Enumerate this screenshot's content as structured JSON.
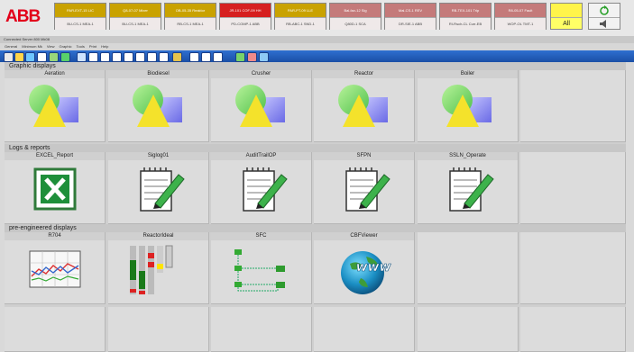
{
  "brand": {
    "logo_text": "ABB"
  },
  "alarm_list": [
    {
      "top": "PAR-EXT-15 LIC",
      "bottom": "BU-CS-1 MEA-1",
      "color": "#c9a200"
    },
    {
      "top": "Q8-07-07 Mixer",
      "bottom": "BU-CS-1 MEA-1",
      "color": "#c9a200"
    },
    {
      "top": "OB-05-35 Reaktor",
      "bottom": "RB-CS-1 MEA-1",
      "color": "#c9a200"
    },
    {
      "top": "JR-101 COF-09 HH",
      "bottom": "PD-COMP-1 ABB",
      "color": "#d61f1f"
    },
    {
      "top": "PAR-PT-09 LLE",
      "bottom": "RB-ABC-1 SND-1",
      "color": "#c9a200"
    },
    {
      "top": "Bal-fav-12 Sig",
      "bottom": "Q80D-1 SCA",
      "color": "#c47a7a"
    },
    {
      "top": "Mal-CS-1 REV",
      "bottom": "DR-SIE-1 ABB",
      "color": "#c47a7a"
    },
    {
      "top": "RB-TEX-101 Trip",
      "bottom": "RI-Rsch-CL Curr-EB",
      "color": "#c47a7a"
    },
    {
      "top": "R8-05-07 Fault",
      "bottom": "WOP-OL TMT-1",
      "color": "#c47a7a"
    }
  ],
  "ack": {
    "top_label": "",
    "bottom_label": "All"
  },
  "window": {
    "title": "Connected Server 800 Mk08"
  },
  "menu": [
    "General",
    "Minimum Mk",
    "View",
    "Graphic",
    "Tools",
    "Print",
    "Help"
  ],
  "sections": [
    {
      "title": "Graphic displays",
      "tiles": [
        {
          "name": "Aeration",
          "icon": "shapes-icon"
        },
        {
          "name": "Biodiesel",
          "icon": "shapes-icon"
        },
        {
          "name": "Crusher",
          "icon": "shapes-icon"
        },
        {
          "name": "Reactor",
          "icon": "shapes-icon"
        },
        {
          "name": "Boiler",
          "icon": "shapes-icon"
        }
      ]
    },
    {
      "title": "Logs & reports",
      "tiles": [
        {
          "name": "EXCEL_Report",
          "icon": "excel-icon"
        },
        {
          "name": "Siglog01",
          "icon": "notepad-icon"
        },
        {
          "name": "AuditTrailOP",
          "icon": "notepad-icon"
        },
        {
          "name": "SFPN",
          "icon": "notepad-icon"
        },
        {
          "name": "SSLN_Operate",
          "icon": "notepad-icon"
        }
      ]
    },
    {
      "title": "pre-engineered displays",
      "tiles": [
        {
          "name": "R704",
          "icon": "trend-chart-icon"
        },
        {
          "name": "ReactorIdeal",
          "icon": "bargraph-icon"
        },
        {
          "name": "SFC",
          "icon": "sfc-diagram-icon"
        },
        {
          "name": "CBFViewer",
          "icon": "www-globe-icon"
        }
      ]
    }
  ]
}
